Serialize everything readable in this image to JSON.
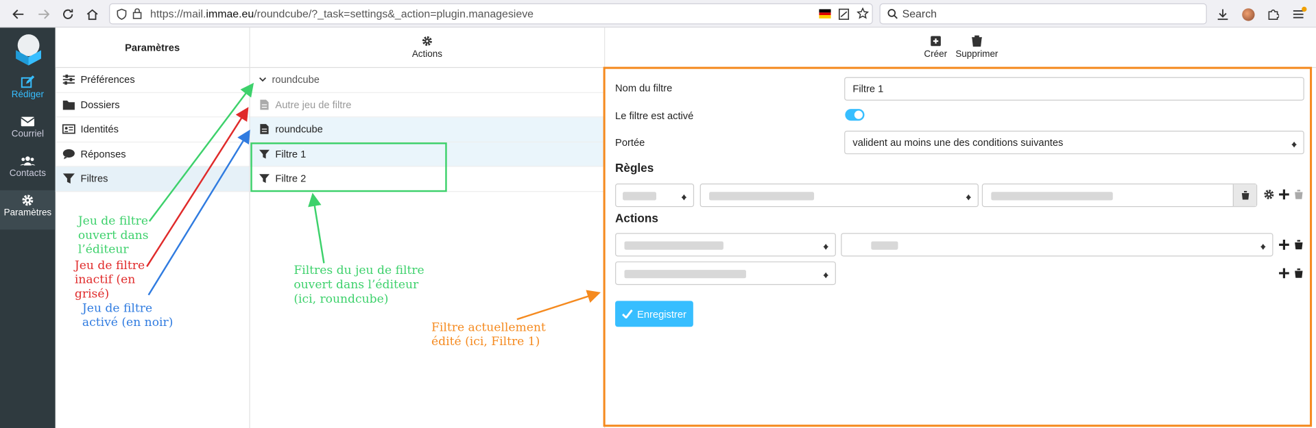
{
  "browser": {
    "url_prefix": "https://mail.",
    "url_domain": "immae.eu",
    "url_rest": "/roundcube/?_task=settings&_action=plugin.managesieve",
    "search_placeholder": "Search"
  },
  "rail": {
    "compose": "Rédiger",
    "mail": "Courriel",
    "contacts": "Contacts",
    "settings": "Paramètres"
  },
  "settings_panel": {
    "title": "Paramètres",
    "items": [
      "Préférences",
      "Dossiers",
      "Identités",
      "Réponses",
      "Filtres"
    ]
  },
  "sets_panel": {
    "actions_label": "Actions",
    "set_header": "roundcube",
    "sets": [
      "Autre jeu de filtre",
      "roundcube"
    ],
    "filters": [
      "Filtre 1",
      "Filtre 2"
    ]
  },
  "toolbar": {
    "create": "Créer",
    "delete": "Supprimer"
  },
  "editor": {
    "name_label": "Nom du filtre",
    "name_value": "Filtre 1",
    "active_label": "Le filtre est activé",
    "scope_label": "Portée",
    "scope_value": "valident au moins une des conditions suivantes",
    "rules_heading": "Règles",
    "actions_heading": "Actions",
    "save_label": "Enregistrer"
  },
  "annotations": {
    "green_set": "Jeu de filtre ouvert dans l’éditeur",
    "red_set": "Jeu de filtre inactif (en grisé)",
    "blue_set": "Jeu de filtre activé (en noir)",
    "filters_note": "Filtres du jeu de filtre ouvert dans l’éditeur (ici, roundcube)",
    "current_note": "Filtre actuellement édité (ici, Filtre 1)"
  },
  "colors": {
    "green": "#3dd16b",
    "red": "#e02a2a",
    "blue": "#2f7be0",
    "orange": "#f58a1f",
    "accent": "#37beff"
  }
}
